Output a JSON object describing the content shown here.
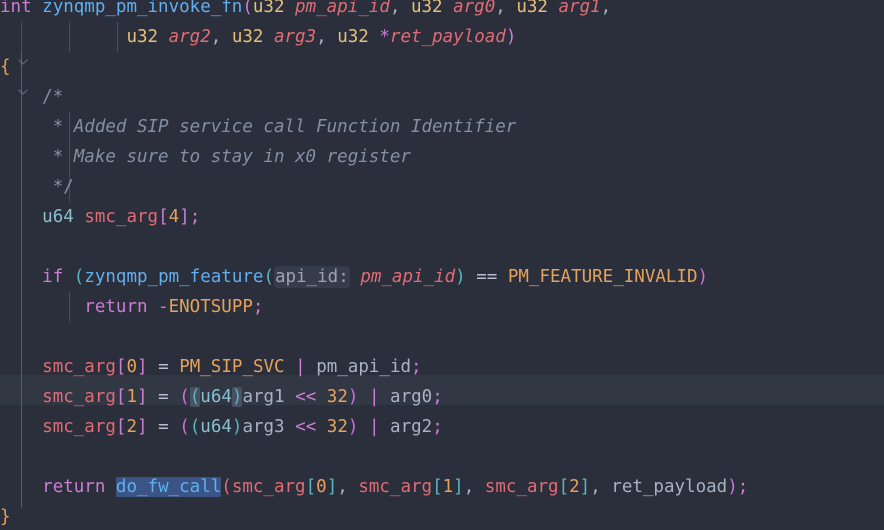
{
  "editor": {
    "language": "c",
    "theme": "one-dark-ish",
    "background_color": "#2b2f3b",
    "current_line_color": "#323744",
    "selection_color": "#3a5585",
    "bracket_match_color": "#4a5163",
    "inlay_hint_color": "#373c4a",
    "font_size_px": 17.5,
    "line_height_px": 30,
    "current_line_index": 12,
    "selected_text": "do_fw_call"
  },
  "code": {
    "full_text": "int zynqmp_pm_invoke_fn(u32 pm_api_id, u32 arg0, u32 arg1,\n            u32 arg2, u32 arg3, u32 *ret_payload)\n{\n    /*\n     * Added SIP service call Function Identifier\n     * Make sure to stay in x0 register\n     */\n    u64 smc_arg[4];\n\n    if (zynqmp_pm_feature(api_id: pm_api_id) == PM_FEATURE_INVALID)\n        return -ENOTSUPP;\n\n    smc_arg[0] = PM_SIP_SVC | pm_api_id;\n    smc_arg[1] = ((u64)arg1 << 32) | arg0;\n    smc_arg[2] = ((u64)arg3 << 32) | arg2;\n\n    return do_fw_call(smc_arg[0], smc_arg[1], smc_arg[2], ret_payload);\n}",
    "lines": [
      {
        "index": 0,
        "text": "int zynqmp_pm_invoke_fn(u32 pm_api_id, u32 arg0, u32 arg1,"
      },
      {
        "index": 1,
        "text": "            u32 arg2, u32 arg3, u32 *ret_payload)"
      },
      {
        "index": 2,
        "text": "{"
      },
      {
        "index": 3,
        "text": "    /*"
      },
      {
        "index": 4,
        "text": "     * Added SIP service call Function Identifier"
      },
      {
        "index": 5,
        "text": "     * Make sure to stay in x0 register"
      },
      {
        "index": 6,
        "text": "     */"
      },
      {
        "index": 7,
        "text": "    u64 smc_arg[4];"
      },
      {
        "index": 8,
        "text": ""
      },
      {
        "index": 9,
        "text": "    if (zynqmp_pm_feature(api_id: pm_api_id) == PM_FEATURE_INVALID)"
      },
      {
        "index": 10,
        "text": "        return -ENOTSUPP;"
      },
      {
        "index": 11,
        "text": ""
      },
      {
        "index": 12,
        "text": "    smc_arg[0] = PM_SIP_SVC | pm_api_id;"
      },
      {
        "index": 13,
        "text": "    smc_arg[1] = ((u64)arg1 << 32) | arg0;"
      },
      {
        "index": 14,
        "text": "    smc_arg[2] = ((u64)arg3 << 32) | arg2;"
      },
      {
        "index": 15,
        "text": ""
      },
      {
        "index": 16,
        "text": "    return do_fw_call(smc_arg[0], smc_arg[1], smc_arg[2], ret_payload);"
      },
      {
        "index": 17,
        "text": "}"
      }
    ],
    "tokens": {
      "kw_int": "int",
      "kw_if": "if",
      "kw_return": "return",
      "fn_name": "zynqmp_pm_invoke_fn",
      "fn_feature": "zynqmp_pm_feature",
      "fn_do_fw_call": "do_fw_call",
      "type_u32": "u32",
      "type_u64": "u64",
      "param_pm_api_id": "pm_api_id",
      "param_arg0": "arg0",
      "param_arg1": "arg1",
      "param_arg2": "arg2",
      "param_arg3": "arg3",
      "param_ret_payload": "ret_payload",
      "var_smc_arg": "smc_arg",
      "const_pm_feature_invalid": "PM_FEATURE_INVALID",
      "const_pm_sip_svc": "PM_SIP_SVC",
      "const_enotsupp": "ENOTSUPP",
      "inlay_hint_api_id": "api_id:",
      "comment_open": "/*",
      "comment_line1": "* Added SIP service call Function Identifier",
      "comment_line2": "* Make sure to stay in x0 register",
      "comment_close": "*/",
      "num_32": "32",
      "num_4": "4",
      "idx_0": "0",
      "idx_1": "1",
      "idx_2": "2"
    }
  }
}
